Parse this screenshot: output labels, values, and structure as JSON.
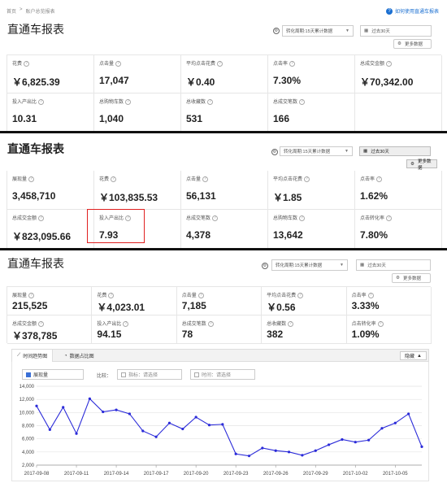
{
  "panel1": {
    "breadcrumb": [
      "首页",
      ">",
      "账户总览报表"
    ],
    "help": "如何使用直通车报表",
    "title": "直通车报表",
    "conversion_select": "转化周期:15天累计数据",
    "date_select": "过去30天",
    "more_data": "更多数据",
    "metrics": [
      {
        "label": "花费",
        "value": "￥6,825.39"
      },
      {
        "label": "点击量",
        "value": "17,047"
      },
      {
        "label": "平均点击花费",
        "value": "￥0.40"
      },
      {
        "label": "点击率",
        "value": "7.30%"
      },
      {
        "label": "总成交金额",
        "value": "￥70,342.00"
      },
      {
        "label": "投入产出比",
        "value": "10.31"
      },
      {
        "label": "总购物车数",
        "value": "1,040"
      },
      {
        "label": "总收藏数",
        "value": "531"
      },
      {
        "label": "总成交笔数",
        "value": "166"
      },
      {
        "label": "",
        "value": ""
      }
    ]
  },
  "panel2": {
    "title": "直通车报表",
    "conversion_select": "转化周期:15天累计数据",
    "date_select": "过去30天",
    "more_data": "更多数据",
    "metrics": [
      {
        "label": "展现量",
        "value": "3,458,710"
      },
      {
        "label": "花费",
        "value": "￥103,835.53"
      },
      {
        "label": "点击量",
        "value": "56,131"
      },
      {
        "label": "平均点击花费",
        "value": "￥1.85"
      },
      {
        "label": "点击率",
        "value": "1.62%"
      },
      {
        "label": "总成交金额",
        "value": "￥823,095.66"
      },
      {
        "label": "投入产出比",
        "value": "7.93"
      },
      {
        "label": "总成交笔数",
        "value": "4,378"
      },
      {
        "label": "总购物车数",
        "value": "13,642"
      },
      {
        "label": "点击转化率",
        "value": "7.80%"
      }
    ]
  },
  "panel3": {
    "title": "直通车报表",
    "conversion_select": "转化周期:15天累计数据",
    "date_select": "过去30天",
    "more_data": "更多数据",
    "metrics": [
      {
        "label": "展现量",
        "value": "215,525"
      },
      {
        "label": "花费",
        "value": "￥4,023.01"
      },
      {
        "label": "点击量",
        "value": "7,185"
      },
      {
        "label": "平均点击花费",
        "value": "￥0.56"
      },
      {
        "label": "点击率",
        "value": "3.33%"
      },
      {
        "label": "总成交金额",
        "value": "￥378,785"
      },
      {
        "label": "投入产出比",
        "value": "94.15"
      },
      {
        "label": "总成交笔数",
        "value": "78"
      },
      {
        "label": "总收藏数",
        "value": "382"
      },
      {
        "label": "点击转化率",
        "value": "1.09%"
      }
    ],
    "tabs": [
      "时间趋势图",
      "数据占比图"
    ],
    "collapse": "隐藏",
    "filters": {
      "metric_selected": "展现量",
      "compare_label": "比较：",
      "indicator_placeholder": "指标：请选择",
      "time_placeholder": "时间：请选择"
    }
  },
  "colors": {
    "line": "#2b2bd9",
    "highlight": "#e02020",
    "link": "#1a6fd1"
  },
  "chart_data": {
    "type": "line",
    "title": "",
    "xlabel": "",
    "ylabel": "",
    "x": [
      "2017-09-08",
      "2017-09-09",
      "2017-09-10",
      "2017-09-11",
      "2017-09-12",
      "2017-09-13",
      "2017-09-14",
      "2017-09-15",
      "2017-09-16",
      "2017-09-17",
      "2017-09-18",
      "2017-09-19",
      "2017-09-20",
      "2017-09-21",
      "2017-09-22",
      "2017-09-23",
      "2017-09-24",
      "2017-09-25",
      "2017-09-26",
      "2017-09-27",
      "2017-09-28",
      "2017-09-29",
      "2017-09-30",
      "2017-10-01",
      "2017-10-02",
      "2017-10-03",
      "2017-10-04",
      "2017-10-05",
      "2017-10-06",
      "2017-10-07"
    ],
    "x_tick_labels": [
      "2017-09-08",
      "2017-09-11",
      "2017-09-14",
      "2017-09-17",
      "2017-09-20",
      "2017-09-23",
      "2017-09-26",
      "2017-09-29",
      "2017-10-02",
      "2017-10-05"
    ],
    "series": [
      {
        "name": "展现量",
        "values": [
          11000,
          7400,
          10800,
          6800,
          12100,
          10100,
          10400,
          9800,
          7200,
          6300,
          8400,
          7500,
          9300,
          8100,
          8200,
          3700,
          3400,
          4600,
          4200,
          4000,
          3500,
          4200,
          5100,
          5900,
          5500,
          5800,
          7600,
          8400,
          9800,
          4800
        ]
      }
    ],
    "yticks": [
      2000,
      4000,
      6000,
      8000,
      10000,
      12000,
      14000
    ],
    "ylim": [
      2000,
      14000
    ],
    "grid": true,
    "legend": "none"
  }
}
